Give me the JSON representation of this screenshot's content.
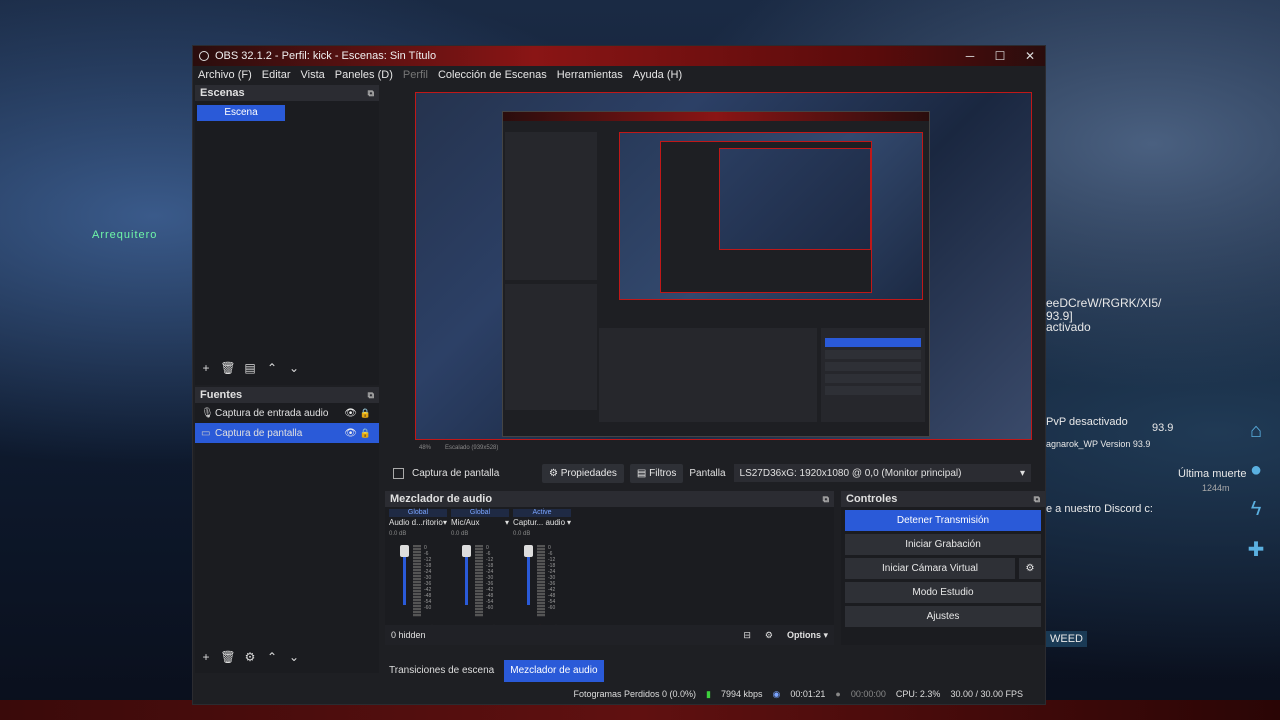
{
  "window": {
    "title": "OBS 32.1.2 - Perfil: kick - Escenas: Sin Título",
    "min": "─",
    "max": "☐",
    "close": "✕"
  },
  "menu": [
    "Archivo (F)",
    "Editar",
    "Vista",
    "Paneles (D)",
    "Perfil",
    "Colección de Escenas",
    "Herramientas",
    "Ayuda (H)"
  ],
  "scenes": {
    "title": "Escenas",
    "items": [
      "Escena"
    ]
  },
  "sources": {
    "title": "Fuentes",
    "items": [
      {
        "label": "Captura de entrada audio",
        "icon": "microphone-icon"
      },
      {
        "label": "Captura de pantalla",
        "icon": "monitor-icon",
        "selected": true
      }
    ]
  },
  "preview": {
    "zoom": "48%",
    "scale": "Escalado (939x528)"
  },
  "props_bar": {
    "source_name": "Captura de pantalla",
    "properties": "Propiedades",
    "filters": "Filtros",
    "screen_label": "Pantalla",
    "screen_value": "LS27D36xG: 1920x1080 @ 0,0 (Monitor principal)"
  },
  "mixer": {
    "title": "Mezclador de audio",
    "channels": [
      {
        "head": "Global",
        "name": "Audio d...ritorio",
        "db": "0.0 dB",
        "muted": false
      },
      {
        "head": "Global",
        "name": "Mic/Aux",
        "db": "0.0 dB",
        "muted": false
      },
      {
        "head": "Active",
        "name": "Captur... audio",
        "db": "0.0 dB",
        "muted": true
      }
    ],
    "ticks": [
      "0",
      "-6",
      "-12",
      "-18",
      "-24",
      "-30",
      "-36",
      "-42",
      "-48",
      "-54",
      "-60"
    ],
    "hidden": "0 hidden",
    "options": "Options"
  },
  "controls": {
    "title": "Controles",
    "stop_stream": "Detener Transmisión",
    "start_record": "Iniciar Grabación",
    "start_vcam": "Iniciar Cámara Virtual",
    "studio": "Modo Estudio",
    "settings": "Ajustes"
  },
  "tabs": [
    "Transiciones de escena",
    "Mezclador de audio"
  ],
  "status": {
    "dropped": "Fotogramas Perdidos 0 (0.0%)",
    "kbps": "7994 kbps",
    "stream_time": "00:01:21",
    "rec_time": "00:00:00",
    "cpu": "CPU: 2.3%",
    "fps": "30.00 / 30.00 FPS"
  },
  "background": {
    "player": "Arrequitero",
    "name_tag": "eeDCreW/RGRK/XI5/",
    "name_tag2": "93.9]",
    "activated": "activado",
    "pvp": "PvP desactivado",
    "pvp_val": "93.9",
    "version": "agnarok_WP Version 93.9",
    "last_death": "Última muerte",
    "last_death_val": "1244m",
    "discord": "e a nuestro Discord c:",
    "weed": "WEED"
  },
  "colors": {
    "accent": "#2a5ad8",
    "titlebar": "#8a1515",
    "panel": "#1e1f23"
  }
}
